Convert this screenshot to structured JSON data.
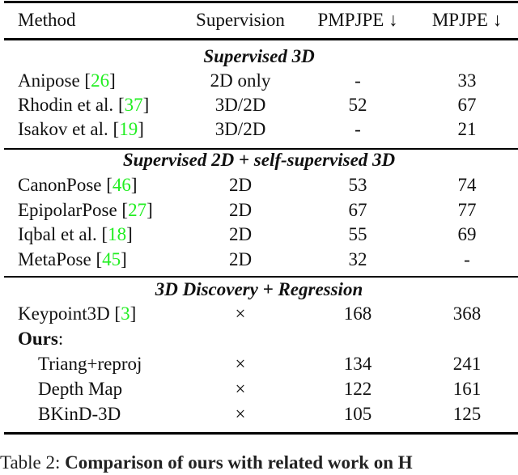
{
  "table": {
    "headers": {
      "method": "Method",
      "supervision": "Supervision",
      "pmpjpe": "PMPJPE ↓",
      "mpjpe": "MPJPE ↓"
    },
    "sections": [
      {
        "title": "Supervised 3D",
        "rows": [
          {
            "method": "Anipose",
            "cite": "26",
            "supervision": "2D only",
            "pmpjpe": "-",
            "mpjpe": "33"
          },
          {
            "method": "Rhodin et al.",
            "cite": "37",
            "supervision": "3D/2D",
            "pmpjpe": "52",
            "mpjpe": "67"
          },
          {
            "method": "Isakov et al.",
            "cite": "19",
            "supervision": "3D/2D",
            "pmpjpe": "-",
            "mpjpe": "21"
          }
        ]
      },
      {
        "title": "Supervised 2D + self-supervised 3D",
        "rows": [
          {
            "method": "CanonPose",
            "cite": "46",
            "supervision": "2D",
            "pmpjpe": "53",
            "mpjpe": "74"
          },
          {
            "method": "EpipolarPose",
            "cite": "27",
            "supervision": "2D",
            "pmpjpe": "67",
            "mpjpe": "77"
          },
          {
            "method": "Iqbal et al.",
            "cite": "18",
            "supervision": "2D",
            "pmpjpe": "55",
            "mpjpe": "69"
          },
          {
            "method": "MetaPose",
            "cite": "45",
            "supervision": "2D",
            "pmpjpe": "32",
            "mpjpe": "-"
          }
        ]
      },
      {
        "title": "3D Discovery + Regression",
        "rows": [
          {
            "method": "Keypoint3D",
            "cite": "3",
            "supervision": "×",
            "pmpjpe": "168",
            "mpjpe": "368"
          }
        ],
        "ours_label": "Ours",
        "ours_suffix": ":",
        "ours_rows": [
          {
            "method": "Triang+reproj",
            "supervision": "×",
            "pmpjpe": "134",
            "mpjpe": "241"
          },
          {
            "method": "Depth Map",
            "supervision": "×",
            "pmpjpe": "122",
            "mpjpe": "161"
          },
          {
            "method": "BKinD-3D",
            "supervision": "×",
            "pmpjpe": "105",
            "mpjpe": "125"
          }
        ]
      }
    ]
  },
  "caption": {
    "lead": "Table 2:",
    "title": "Comparison of ours with related work on H"
  },
  "colors": {
    "citation": "#22ee22",
    "rule": "#000000",
    "text": "#111111"
  }
}
